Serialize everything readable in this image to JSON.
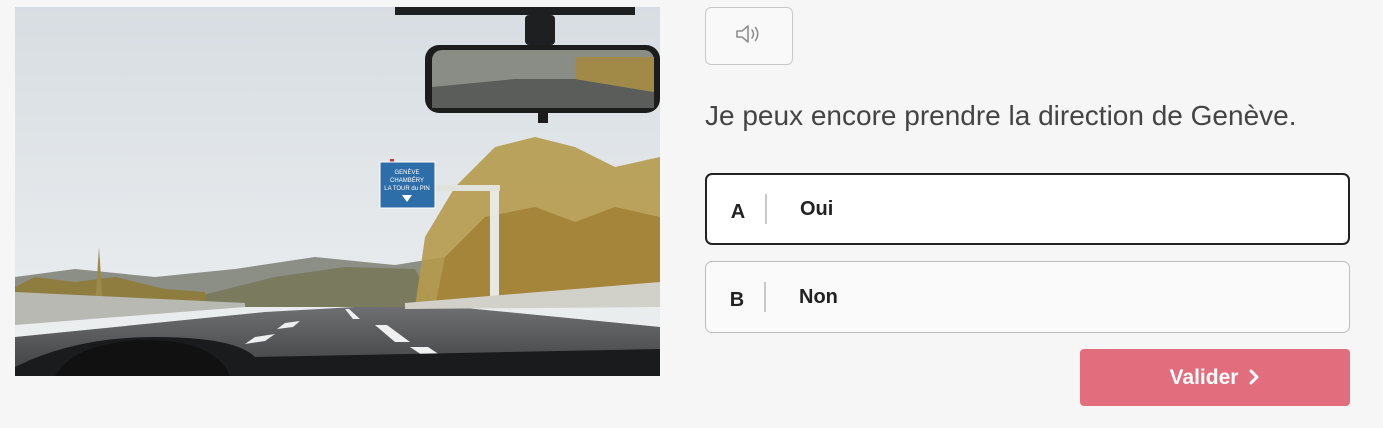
{
  "media": {
    "description": "highway-windshield-photo",
    "sign": {
      "line1": "GENÈVE",
      "line2": "CHAMBÉRY",
      "line3": "LA TOUR du PIN"
    }
  },
  "audio": {
    "icon": "speaker-icon"
  },
  "question": {
    "text": "Je peux encore prendre la direction de Genève."
  },
  "answers": [
    {
      "letter": "A",
      "label": "Oui",
      "selected": true
    },
    {
      "letter": "B",
      "label": "Non",
      "selected": false
    }
  ],
  "validate": {
    "label": "Valider",
    "icon": "chevron-right-icon",
    "color": "#e26d7c"
  }
}
